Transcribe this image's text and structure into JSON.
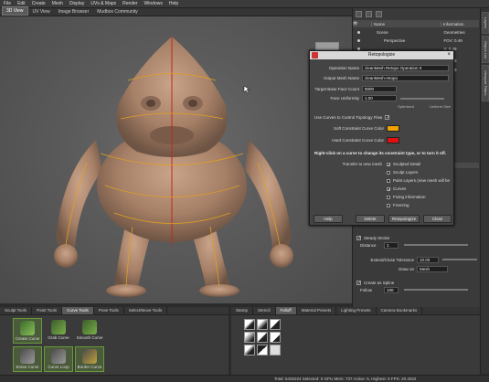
{
  "menu": [
    "File",
    "Edit",
    "Create",
    "Mesh",
    "Display",
    "UVs & Maps",
    "Render",
    "Windows",
    "Help"
  ],
  "view_tabs": [
    "3D View",
    "UV View",
    "Image Browser",
    "Mudbox Community"
  ],
  "viewcube_label": "FRONT",
  "outliner": {
    "col_name": "Name",
    "col_info": "Information",
    "rows": [
      {
        "name": "Scene",
        "info": "Geometries"
      },
      {
        "name": "Perspective",
        "info": "FOV: 0.49"
      },
      {
        "name": "",
        "info": "V: 0.49"
      },
      {
        "name": "",
        "info": "V: 0.49"
      },
      {
        "name": "",
        "info": "V: 0.49"
      }
    ]
  },
  "side_tabs": [
    "Layers",
    "Object List",
    "Viewport Filters"
  ],
  "right_props": {
    "steady_stroke": "Steady Stroke",
    "distance_label": "Distance",
    "distance_value": "1",
    "tolerance_label": "Extend/Close Tolerance",
    "tolerance_value": "10.00",
    "draw_on_label": "Draw on",
    "draw_on_value": "Mesh",
    "create_spline": "Create as Spline",
    "follow_label": "Follow",
    "follow_value": "100"
  },
  "dialog": {
    "title": "Retopologize",
    "operation_name_label": "Operation Name",
    "operation_name_value": "cleanMesh Retopo Operation 0",
    "output_mesh_label": "Output Mesh Name",
    "output_mesh_value": "cleanMesh-retopo",
    "target_face_label": "Target Base Face Count",
    "target_face_value": "8000",
    "face_uniformity_label": "Face Uniformity",
    "face_uniformity_value": "1.00",
    "optimized": "Optimized",
    "uniform_size": "Uniform Size",
    "use_curves_label": "Use Curves to Control Topology Flow",
    "soft_curve_label": "Soft Constraint Curve Color",
    "soft_curve_color": "#f0a000",
    "hard_curve_label": "Hard Constraint Curve Color",
    "hard_curve_color": "#e01010",
    "hint": "Right-click on a curve to change its constraint type, or to turn it off.",
    "transfer_label": "Transfer to new mesh",
    "transfer_items": [
      {
        "label": "Sculpted Detail",
        "checked": true
      },
      {
        "label": "Sculpt Layers",
        "checked": false
      },
      {
        "label": "Paint Layers (new mesh will be",
        "checked": false
      },
      {
        "label": "Curves",
        "checked": true
      },
      {
        "label": "Fixing information",
        "checked": false
      },
      {
        "label": "Freezing",
        "checked": false
      }
    ],
    "btn_help": "Help",
    "btn_delete": "Delete",
    "btn_retopologize": "Retopologize",
    "btn_close": "Close"
  },
  "tool_tabs": [
    "Sculpt Tools",
    "Paint Tools",
    "Curve Tools",
    "Pose Tools",
    "Select/Move Tools"
  ],
  "tools": [
    "Create Curve",
    "Grab Curve",
    "Smooth Curve",
    "Erase Curve",
    "Curve Loop",
    "Border Curve"
  ],
  "stamp_tabs": [
    "Stamp",
    "Stencil",
    "Falloff",
    "Material Presets",
    "Lighting Presets",
    "Camera Bookmarks"
  ],
  "status": "Total: 5426224  Selected: 0  GPU Mem: 737  Active: 5, Highest: 5  FPS: 20.4022",
  "colors": {
    "accent_green": "#6a9a3a",
    "dialog_bg": "#444444",
    "viewport_bg": "#5a5a5a"
  }
}
